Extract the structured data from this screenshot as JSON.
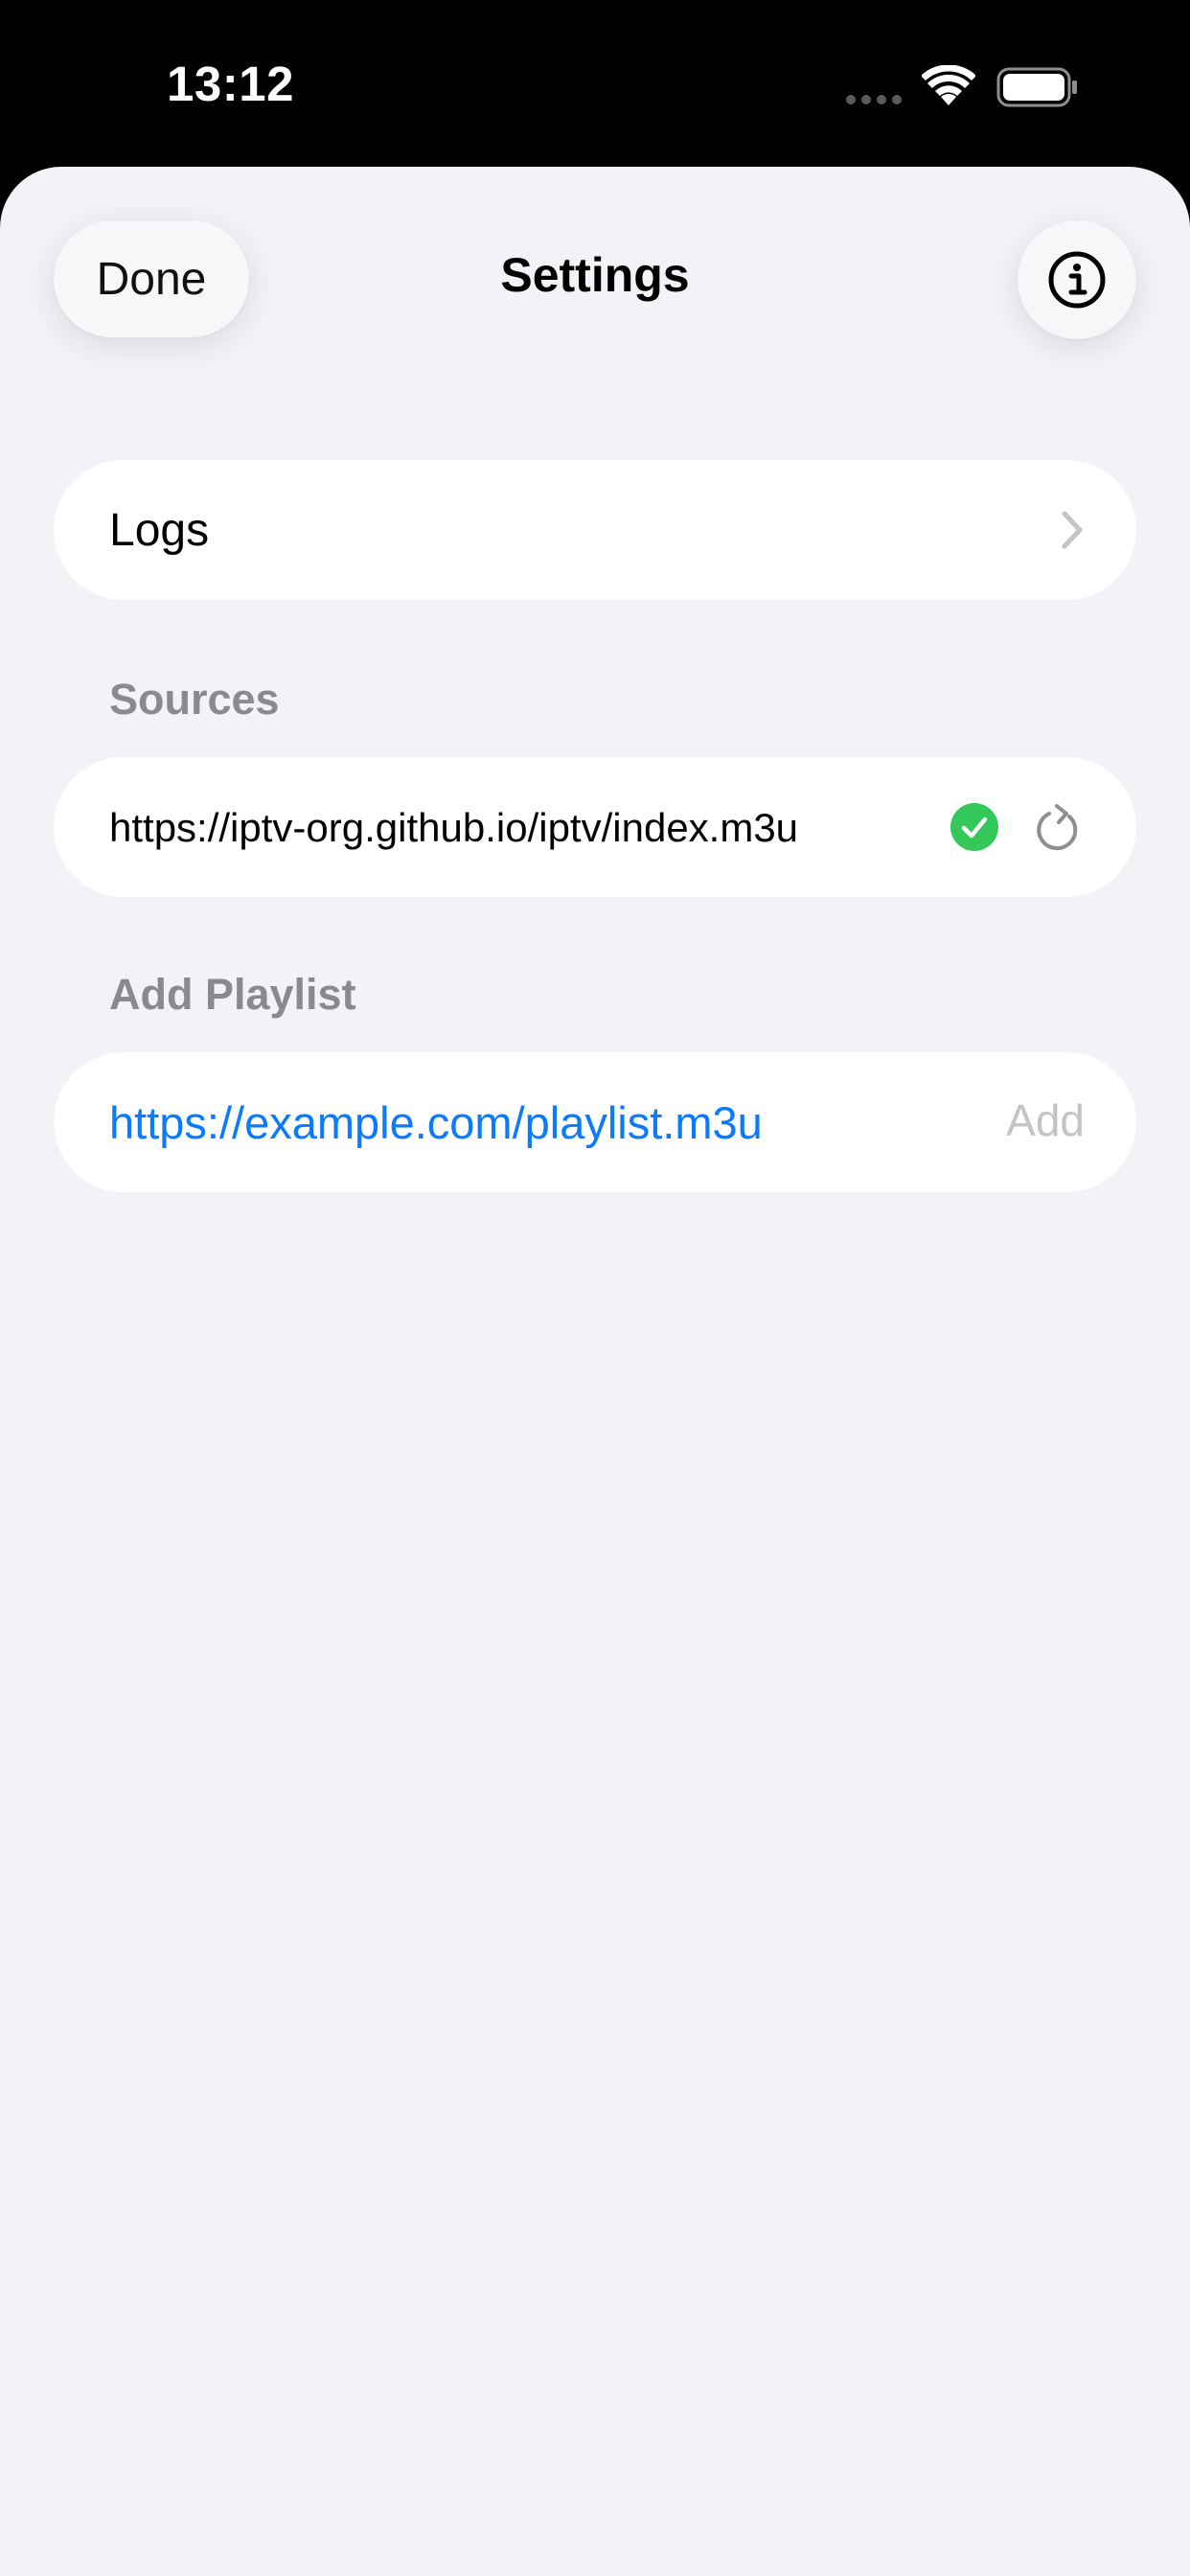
{
  "status_bar": {
    "time": "13:12"
  },
  "nav": {
    "done_label": "Done",
    "title": "Settings",
    "info_icon": "info-circle-icon"
  },
  "logs": {
    "label": "Logs",
    "icon": "chevron-right-icon"
  },
  "sources": {
    "header": "Sources",
    "items": [
      {
        "url": "https://iptv-org.github.io/iptv/index.m3u",
        "status_icon": "checkmark-circle-icon",
        "status_color": "#34c759",
        "action_icon": "refresh-icon"
      }
    ]
  },
  "add_playlist": {
    "header": "Add Playlist",
    "input_value": "https://example.com/playlist.m3u",
    "add_label": "Add"
  },
  "colors": {
    "background": "#f2f2f7",
    "link": "#0a7aff",
    "section_header": "#8a8a8e",
    "disabled": "#c3c3c8"
  }
}
